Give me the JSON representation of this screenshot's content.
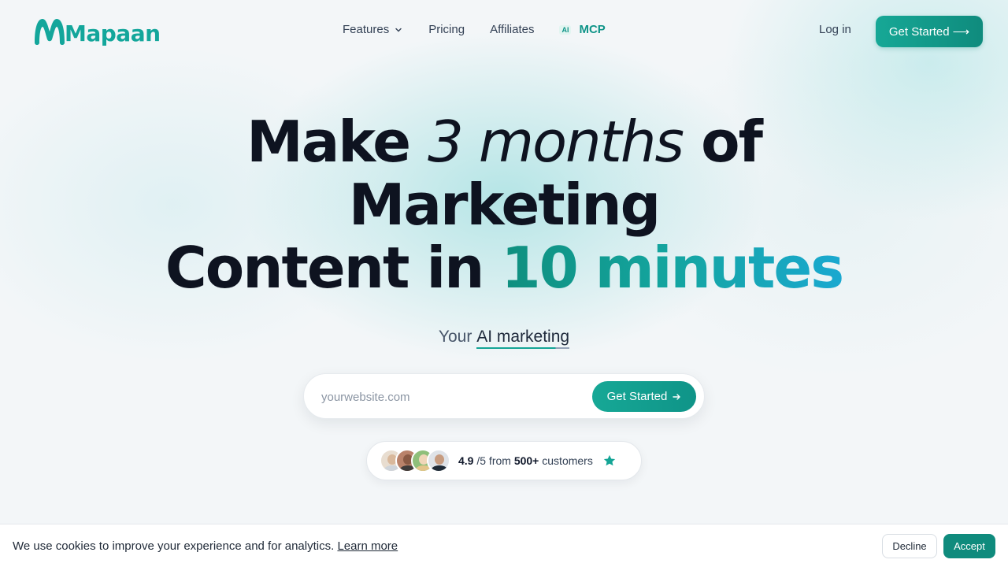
{
  "brand": {
    "name": "Mapaan",
    "color": "#13a69b"
  },
  "nav": {
    "features": "Features",
    "pricing": "Pricing",
    "affiliates": "Affiliates",
    "ai_badge": "AI",
    "mcp": "MCP",
    "login": "Log in",
    "cta": "Get Started",
    "cta_arrow": "⟶"
  },
  "hero": {
    "line1_a": "Make",
    "line1_b": "3 months",
    "line1_c": "of",
    "line2": "Marketing",
    "line3_a": "Content in",
    "line3_b": "10 minutes",
    "sub_a": "Your",
    "sub_b": "AI marketing"
  },
  "search": {
    "placeholder": "yourwebsite.com",
    "value": "",
    "button": "Get Started",
    "button_arrow": "→"
  },
  "rating": {
    "score": "4.9",
    "scale": "/5 from",
    "count": "500+",
    "suffix": "customers"
  },
  "cookie": {
    "text": "We use cookies to improve your experience and for analytics.",
    "link": "Learn more",
    "decline": "Decline",
    "accept": "Accept"
  },
  "colors": {
    "accent": "#0f8b7d",
    "accent_light": "#16a896",
    "gradient_end": "#1aa8d0"
  }
}
